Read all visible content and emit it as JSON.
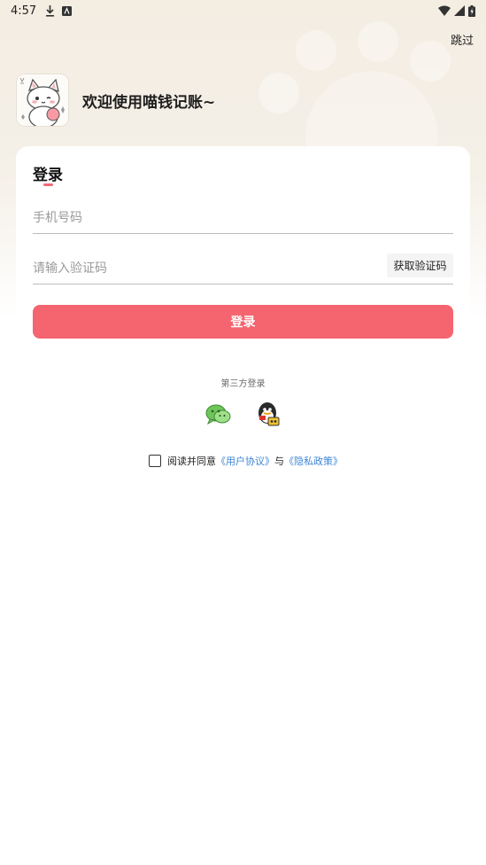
{
  "status": {
    "time": "4:57"
  },
  "skip_label": "跳过",
  "welcome": "欢迎使用喵钱记账~",
  "login": {
    "title": "登录",
    "phone_placeholder": "手机号码",
    "code_placeholder": "请输入验证码",
    "get_code_label": "获取验证码",
    "submit_label": "登录"
  },
  "third_party": {
    "label": "第三方登录",
    "providers": [
      "wechat-icon",
      "qq-icon"
    ]
  },
  "agreement": {
    "prefix": "阅读并同意",
    "user_agreement": "《用户协议》",
    "joiner": "与",
    "privacy_policy": "《隐私政策》"
  },
  "colors": {
    "accent": "#f4656f",
    "link": "#3f86d6",
    "background_top": "#f3ede2"
  }
}
